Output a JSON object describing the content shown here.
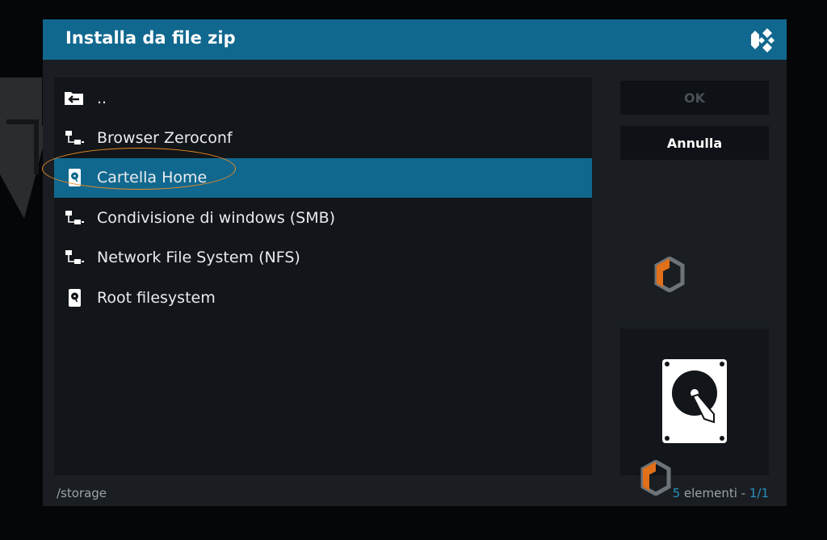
{
  "dialog": {
    "title": "Installa da file zip"
  },
  "list": {
    "items": [
      {
        "label": "..",
        "icon": "folder-back-icon"
      },
      {
        "label": "Browser Zeroconf",
        "icon": "network-icon"
      },
      {
        "label": "Cartella Home",
        "icon": "harddisk-icon",
        "selected": true
      },
      {
        "label": "Condivisione di windows (SMB)",
        "icon": "network-icon"
      },
      {
        "label": "Network File System (NFS)",
        "icon": "network-icon"
      },
      {
        "label": "Root filesystem",
        "icon": "harddisk-icon"
      }
    ]
  },
  "buttons": {
    "ok_label": "OK",
    "cancel_label": "Annulla"
  },
  "footer": {
    "path": "/storage",
    "count_number": "5",
    "count_text": " elementi - ",
    "page": "1/1"
  },
  "colors": {
    "header": "#11688f",
    "selected_row": "#11688f",
    "annotation_ring": "#e88a24",
    "accent_text": "#2b8fc1"
  }
}
